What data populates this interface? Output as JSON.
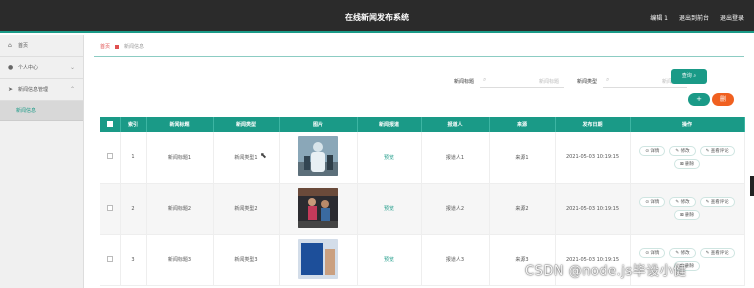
{
  "header": {
    "title": "在线新闻发布系统",
    "links": [
      "编辑 1",
      "退出到前台",
      "退出登录"
    ]
  },
  "sidebar": {
    "items": [
      {
        "label": "首页",
        "icon": "home-icon"
      },
      {
        "label": "个人中心",
        "icon": "user-icon"
      },
      {
        "label": "新闻信息管理",
        "icon": "send-icon"
      }
    ],
    "sub_item": "新闻信息"
  },
  "breadcrumb": {
    "home": "首页",
    "current": "新闻信息"
  },
  "search": {
    "title_label": "新闻标题",
    "title_placeholder": "新闻标题",
    "type_label": "新闻类型",
    "type_placeholder": "新闻类型",
    "query_button": "查询"
  },
  "actions": {
    "add": "+",
    "delete": "删"
  },
  "table": {
    "headers": [
      "",
      "索引",
      "新闻标题",
      "新闻类型",
      "图片",
      "新闻报道",
      "报道人",
      "来源",
      "发布日期",
      "操作"
    ],
    "rows": [
      {
        "index": "1",
        "title": "新闻标题1",
        "type": "新闻类型1",
        "report": "预览",
        "reporter": "报道人1",
        "source": "来源1",
        "date": "2021-05-03 10:19:15"
      },
      {
        "index": "2",
        "title": "新闻标题2",
        "type": "新闻类型2",
        "report": "预览",
        "reporter": "报道人2",
        "source": "来源2",
        "date": "2021-05-03 10:19:15"
      },
      {
        "index": "3",
        "title": "新闻标题3",
        "type": "新闻类型3",
        "report": "预览",
        "reporter": "报道人3",
        "source": "来源3",
        "date": "2021-05-03 10:19:15"
      }
    ],
    "ops": [
      "详情",
      "修改",
      "查看评论",
      "删除"
    ]
  },
  "watermark": "CSDN @node.js毕设小健",
  "colors": {
    "accent": "#1a9a87",
    "danger": "#f06020",
    "topbar": "#2b2b2b"
  }
}
